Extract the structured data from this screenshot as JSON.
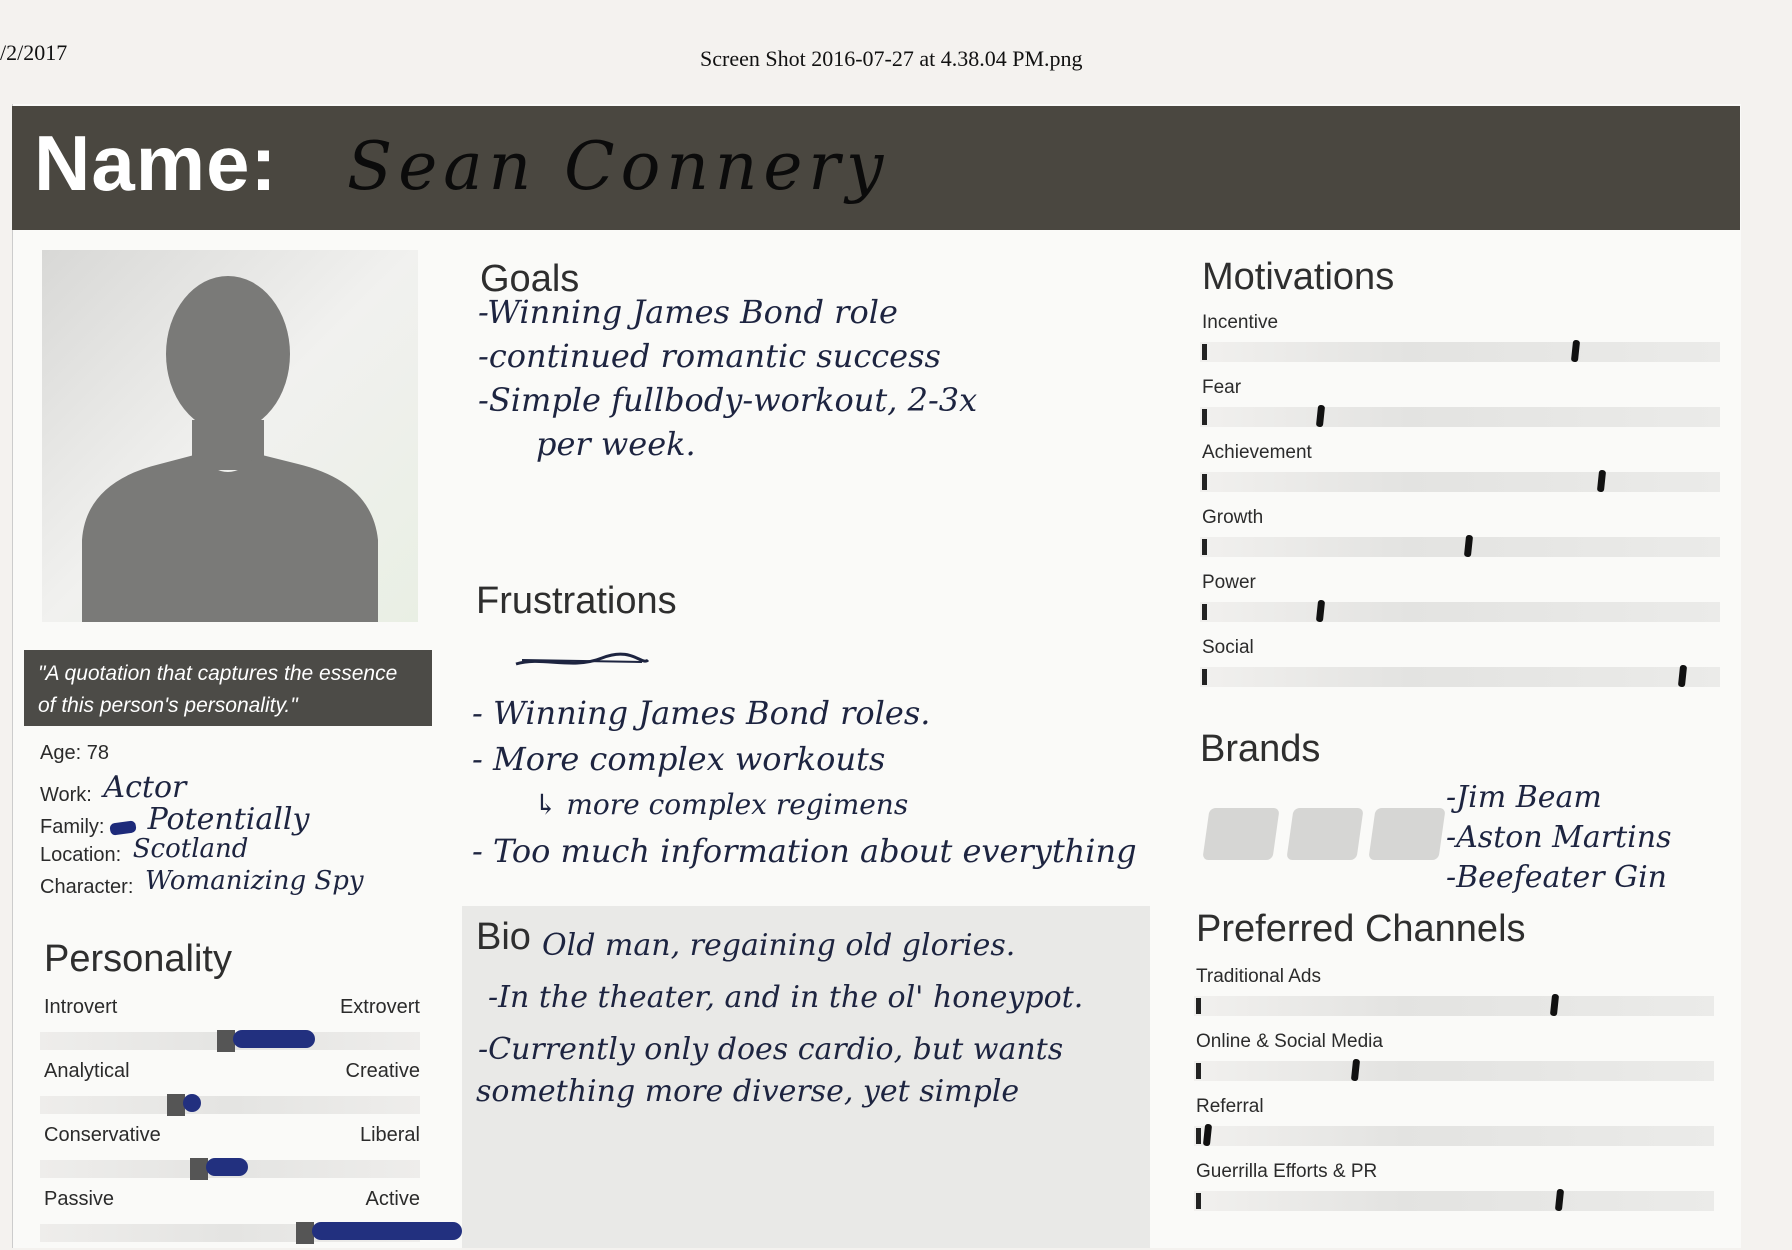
{
  "print_header": {
    "date": "/2/2017",
    "title": "Screen Shot 2016-07-27 at 4.38.04 PM.png"
  },
  "persona": {
    "name_label": "Name:",
    "name_value": "Sean Connery"
  },
  "quote": "\"A quotation that captures the essence of this person's personality.\"",
  "facts": [
    {
      "label": "Age:",
      "value": "78"
    },
    {
      "label": "Work:",
      "value": "Actor"
    },
    {
      "label": "Family:",
      "value": "Potentially"
    },
    {
      "label": "Location:",
      "value": "Scotland"
    },
    {
      "label": "Character:",
      "value": "Womanizing Spy"
    }
  ],
  "personality": {
    "title": "Personality",
    "scales": [
      {
        "left": "Introvert",
        "right": "Extrovert",
        "level": 0.57
      },
      {
        "left": "Analytical",
        "right": "Creative",
        "level": 0.44
      },
      {
        "left": "Conservative",
        "right": "Liberal",
        "level": 0.5
      },
      {
        "left": "Passive",
        "right": "Active",
        "level": 0.78
      }
    ]
  },
  "goals": {
    "title": "Goals",
    "items": [
      "-Winning James Bond role",
      "-continued romantic success",
      "-Simple fullbody-workout, 2-3x",
      "per week."
    ]
  },
  "frustrations": {
    "title": "Frustrations",
    "items": [
      "- Winning James Bond roles.",
      "- More complex workouts",
      "↳ more complex regimens",
      "- Too much information about everything"
    ]
  },
  "bio": {
    "title": "Bio",
    "lines": [
      "Old man, regaining old glories.",
      "-In the theater, and in the ol' honeypot.",
      "-Currently only does cardio, but wants",
      "something more diverse, yet simple"
    ]
  },
  "motivations": {
    "title": "Motivations",
    "items": [
      {
        "label": "Incentive",
        "level": 0.73
      },
      {
        "label": "Fear",
        "level": 0.23
      },
      {
        "label": "Achievement",
        "level": 0.78
      },
      {
        "label": "Growth",
        "level": 0.52
      },
      {
        "label": "Power",
        "level": 0.23
      },
      {
        "label": "Social",
        "level": 0.94
      }
    ]
  },
  "brands": {
    "title": "Brands",
    "items": [
      "-Jim Beam",
      "-Aston Martins",
      "-Beefeater Gin"
    ]
  },
  "channels": {
    "title": "Preferred Channels",
    "items": [
      {
        "label": "Traditional Ads",
        "level": 0.7
      },
      {
        "label": "Online & Social Media",
        "level": 0.31
      },
      {
        "label": "Referral",
        "level": 0.02
      },
      {
        "label": "Guerrilla Efforts & PR",
        "level": 0.71
      }
    ]
  },
  "colors": {
    "header_bar": "#4a4740",
    "ink": "#1d2440",
    "blue_ink": "#22307f"
  }
}
